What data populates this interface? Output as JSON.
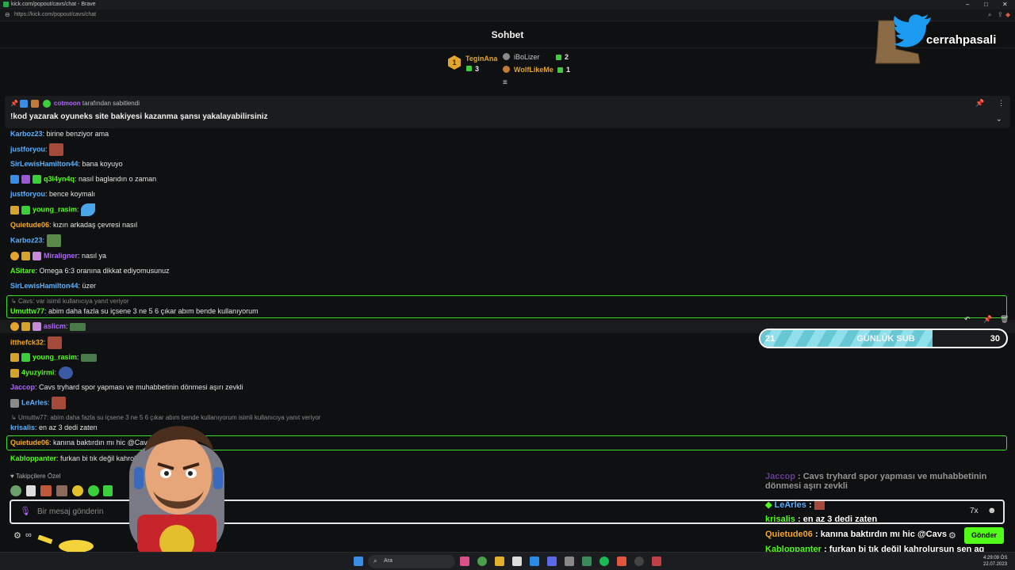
{
  "browser": {
    "title": "kick.com/popout/cavs/chat - Brave",
    "url": "https://kick.com/popout/cavs/chat"
  },
  "chat": {
    "title": "Sohbet",
    "leaderboard": [
      {
        "rank": "1",
        "name": "TeginAna",
        "value": "3"
      },
      {
        "name": "iBoLizer",
        "value": "2"
      },
      {
        "name": "WolfLikeMe",
        "value": "1"
      }
    ],
    "pinned": {
      "user": "cotmoon",
      "suffix": "tarafından sabitlendi",
      "message": "!kod yazarak oyuneks site bakiyesi kazanma şansı yakalayabilirsiniz"
    },
    "messages": [
      {
        "user": "Karboz23",
        "text": "birine benziyor ama"
      },
      {
        "user": "justforyou",
        "text": ""
      },
      {
        "user": "SirLewisHamilton44",
        "text": "bana koyuyo"
      },
      {
        "user": "q3l4yn4q",
        "text": "nasıl baglandın o zaman"
      },
      {
        "user": "justforyou",
        "text": "bence koymalı"
      },
      {
        "user": "young_rasim",
        "text": ""
      },
      {
        "user": "Quietude06",
        "text": "kızın arkadaş çevresi nasıl"
      },
      {
        "user": "Karboz23",
        "text": ""
      },
      {
        "user": "Miraligner",
        "text": "nasıl ya"
      },
      {
        "user": "ASitare",
        "text": "Omega 6:3 oranına dikkat ediyomusunuz"
      },
      {
        "user": "SirLewisHamilton44",
        "text": "üzer"
      },
      {
        "reply": "Cavs: var isimli kullanıcıya yanıt veriyor",
        "user": "Umuttw77",
        "text": "abim daha fazla su içsene 3 ne 5 6 çıkar abım bende kullanıyorum"
      },
      {
        "user": "aslicm",
        "text": ""
      },
      {
        "user": "itthefck32",
        "text": ""
      },
      {
        "user": "young_rasim",
        "text": ""
      },
      {
        "user": "4yuzyirmi",
        "text": ""
      },
      {
        "user": "Jaccop",
        "text": "Cavs tryhard spor yapması ve muhabbetinin dönmesi aşırı zevkli"
      },
      {
        "user": "LeArles",
        "text": ""
      },
      {
        "reply": "Umuttw77: abim daha fazla su içsene 3 ne 5 6 çıkar abım bende kullanıyorum isimli kullanıcıya yanıt veriyor",
        "user": "krisalis",
        "text": "en az 3 dedi zaten"
      },
      {
        "user": "Quietude06",
        "text": "kanına baktırdın mı hic @Cavs"
      },
      {
        "user": "Kabloppanter",
        "text": "furkan bi tık değil kahrolursun sen aq"
      }
    ],
    "followers_only_label": "Takipçilere Özel",
    "input_placeholder": "Bir mesaj gönderin",
    "send_label": "Gönder"
  },
  "subgoal": {
    "current": "21",
    "label": "GÜNLÜK SUB",
    "goal": "30",
    "progress": 0.7
  },
  "overlay_chat": [
    {
      "user": "Jaccop",
      "text": "Cavs tryhard spor yapması ve muhabbetinin dönmesi aşırı zevkli"
    },
    {
      "user": "LeArles",
      "text": ""
    },
    {
      "user": "krisalis",
      "text": "en az 3 dedi zaten"
    },
    {
      "user": "Quietude06",
      "text": "kanına baktırdın mı hic @Cavs"
    },
    {
      "user": "Kabloppanter",
      "text": "furkan bi tık değil kahrolursun sen aq"
    }
  ],
  "twitter": {
    "handle": "cerrahpasali"
  },
  "taskbar": {
    "search_label": "Ara",
    "time": "4:29:09 ÖS",
    "date": "22.07.2023"
  },
  "colors": {
    "kick_green": "#53fc18",
    "accent_green": "#3ddc2b"
  }
}
